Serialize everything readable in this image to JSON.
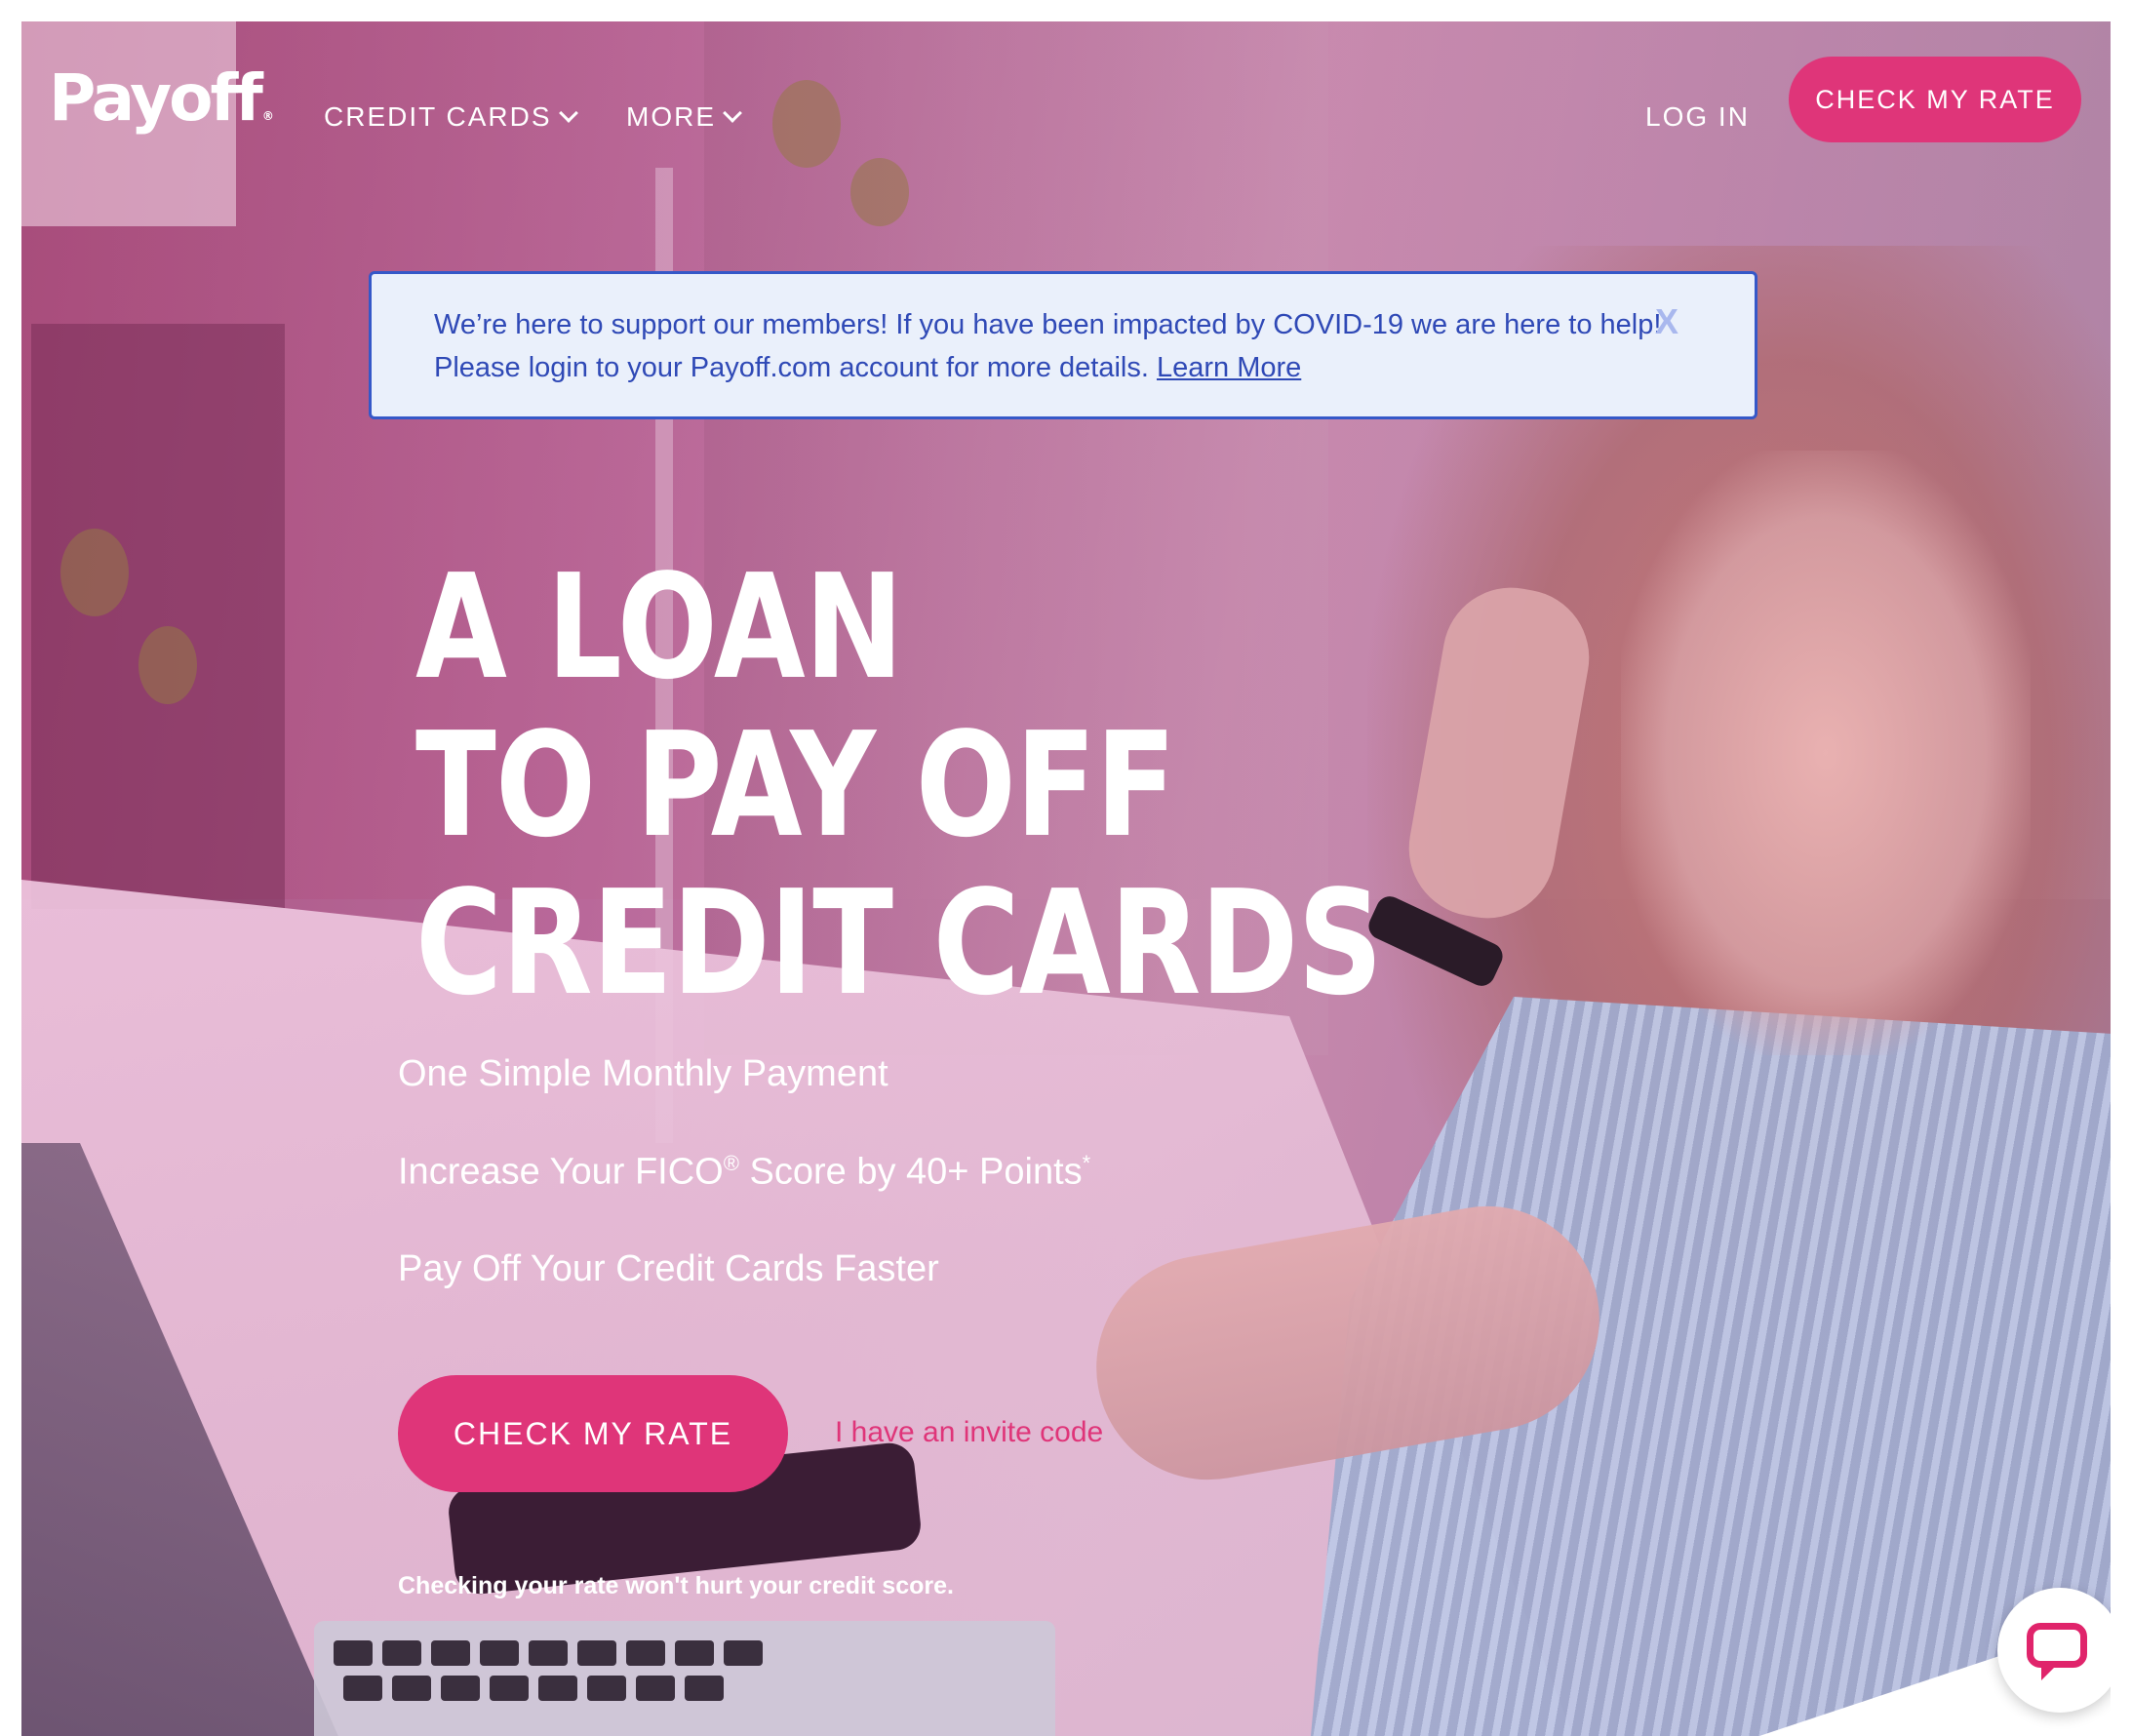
{
  "header": {
    "logo": "Payoff",
    "logo_mark": "®",
    "nav": [
      {
        "label": "CREDIT CARDS"
      },
      {
        "label": "MORE"
      }
    ],
    "login_label": "LOG IN",
    "cta_label": "CHECK MY RATE"
  },
  "alert": {
    "text": "We’re here to support our members! If you have been impacted by COVID-19 we are here to help! Please login to your Payoff.com account for more details.",
    "link_label": "Learn More",
    "close_label": "X"
  },
  "hero": {
    "title_lines": [
      "A LOAN",
      "TO PAY OFF",
      "CREDIT CARDS"
    ],
    "bullets": {
      "one": "One Simple Monthly Payment",
      "two_prefix": "Increase Your FICO",
      "two_reg": "®",
      "two_suffix": " Score by 40+ Points",
      "two_star": "*",
      "three": "Pay Off Your Credit Cards Faster"
    },
    "cta_label": "CHECK MY RATE",
    "invite_label": "I have an invite code",
    "disclaimer": "Checking your rate won't hurt your credit score."
  },
  "colors": {
    "brand_pink": "#df3579",
    "alert_blue": "#2f49b6",
    "alert_bg": "#eaf0fb"
  },
  "icons": {
    "nav_dropdown": "chevron-down-icon",
    "chat": "chat-bubble-icon"
  }
}
